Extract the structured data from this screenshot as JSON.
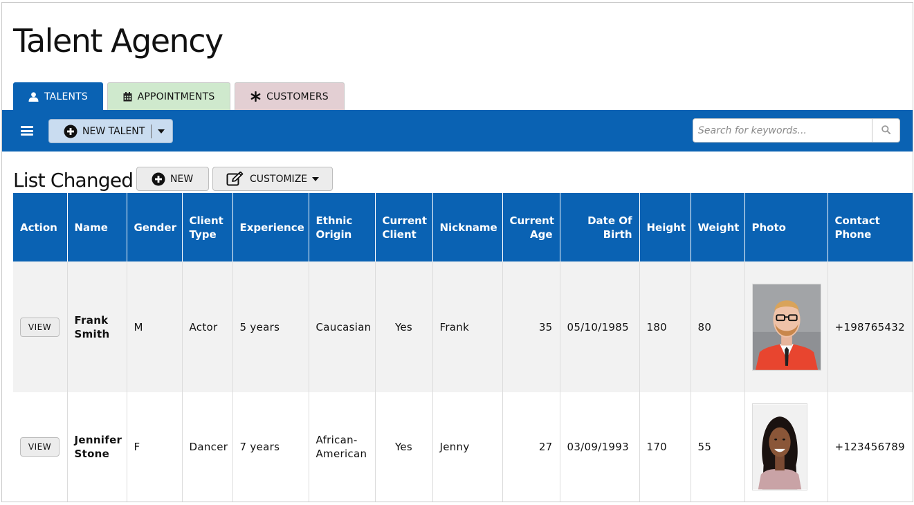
{
  "app": {
    "title": "Talent Agency"
  },
  "tabs": [
    {
      "label": "TALENTS",
      "icon": "user-icon",
      "active": true,
      "color": "#0a62b3"
    },
    {
      "label": "APPOINTMENTS",
      "icon": "calendar-icon",
      "active": false,
      "color": "#cfe9cd"
    },
    {
      "label": "CUSTOMERS",
      "icon": "asterisk-icon",
      "active": false,
      "color": "#e3cfd3"
    }
  ],
  "toolbar": {
    "menu_icon": "hamburger-icon",
    "new_button_label": "NEW TALENT",
    "search_placeholder": "Search for keywords...",
    "search_icon": "search-icon",
    "color": "#0a62b3"
  },
  "list": {
    "title": "List Changed",
    "new_label": "NEW",
    "customize_label": "CUSTOMIZE"
  },
  "table": {
    "columns": [
      "Action",
      "Name",
      "Gender",
      "Client Type",
      "Experience",
      "Ethnic Origin",
      "Current Client",
      "Nickname",
      "Current Age",
      "Date Of Birth",
      "Height",
      "Weight",
      "Photo",
      "Contact Phone"
    ],
    "rows": [
      {
        "action": "VIEW",
        "name": "Frank Smith",
        "gender": "M",
        "client_type": "Actor",
        "experience": "5 years",
        "ethnic_origin": "Caucasian",
        "current_client": "Yes",
        "nickname": "Frank",
        "current_age": "35",
        "dob": "05/10/1985",
        "height": "180",
        "weight": "80",
        "photo": "man-portrait-photo",
        "phone": "+198765432"
      },
      {
        "action": "VIEW",
        "name": "Jennifer Stone",
        "gender": "F",
        "client_type": "Dancer",
        "experience": "7 years",
        "ethnic_origin": "African-American",
        "current_client": "Yes",
        "nickname": "Jenny",
        "current_age": "27",
        "dob": "03/09/1993",
        "height": "170",
        "weight": "55",
        "photo": "woman-portrait-photo",
        "phone": "+123456789"
      }
    ]
  }
}
